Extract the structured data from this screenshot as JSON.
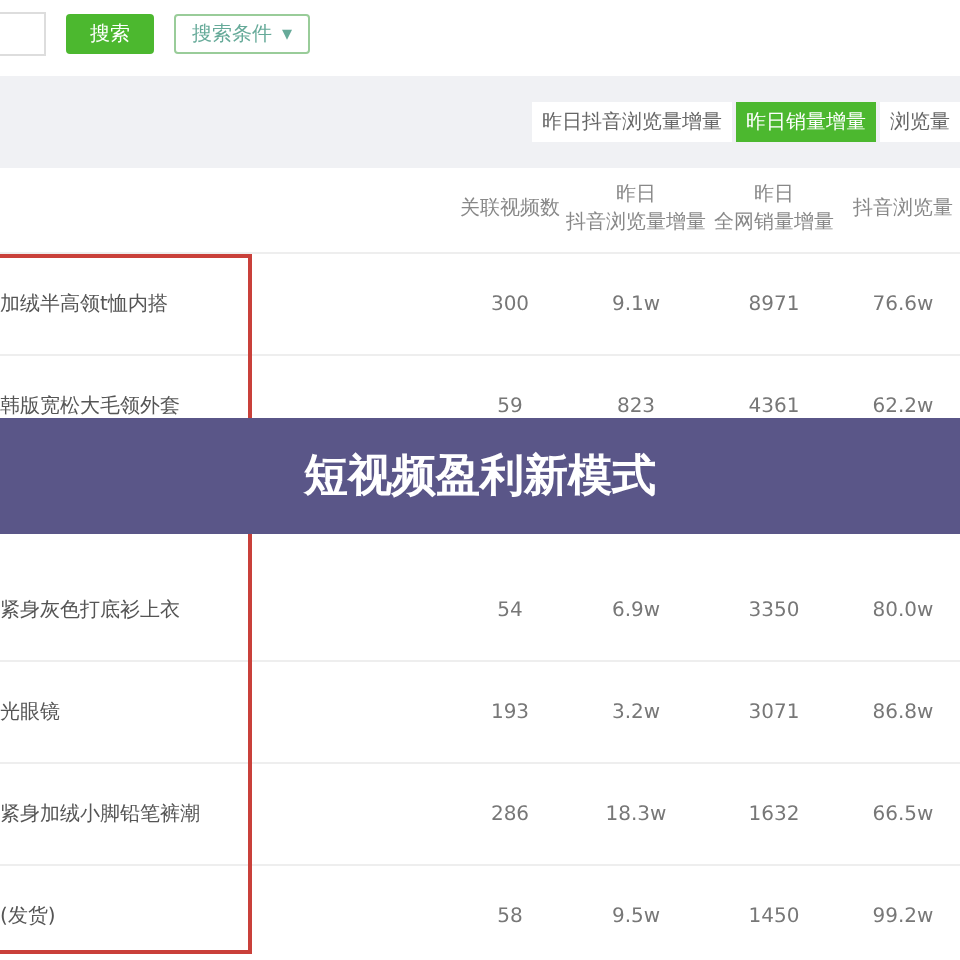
{
  "toolbar": {
    "search_button": "搜索",
    "filter_button": "搜索条件",
    "filter_caret": "▾"
  },
  "sort_tabs": [
    {
      "label": "昨日抖音浏览量增量",
      "selected": false
    },
    {
      "label": "昨日销量增量",
      "selected": true
    },
    {
      "label": "浏览量",
      "selected": false
    }
  ],
  "table": {
    "columns": [
      {
        "lines": [
          "关联视频数"
        ]
      },
      {
        "lines": [
          "昨日",
          "抖音浏览量增量"
        ]
      },
      {
        "lines": [
          "昨日",
          "全网销量增量"
        ]
      },
      {
        "lines": [
          "抖音浏览量"
        ]
      }
    ],
    "rows": [
      {
        "kind": "product",
        "cells": [
          "加绒半高领t恤内搭",
          "300",
          "9.1w",
          "8971",
          "76.6w"
        ]
      },
      {
        "kind": "product",
        "cells": [
          "韩版宽松大毛领外套",
          "59",
          "823",
          "4361",
          "62.2w"
        ]
      },
      {
        "kind": "banner",
        "title": "短视频盈利新模式"
      },
      {
        "kind": "product",
        "cells": [
          "紧身灰色打底衫上衣",
          "54",
          "6.9w",
          "3350",
          "80.0w"
        ]
      },
      {
        "kind": "product",
        "cells": [
          "光眼镜",
          "193",
          "3.2w",
          "3071",
          "86.8w"
        ]
      },
      {
        "kind": "product",
        "cells": [
          "紧身加绒小脚铅笔裤潮",
          "286",
          "18.3w",
          "1632",
          "66.5w"
        ]
      },
      {
        "kind": "product",
        "cells": [
          "(发货)",
          "58",
          "9.5w",
          "1450",
          "99.2w"
        ]
      }
    ]
  }
}
